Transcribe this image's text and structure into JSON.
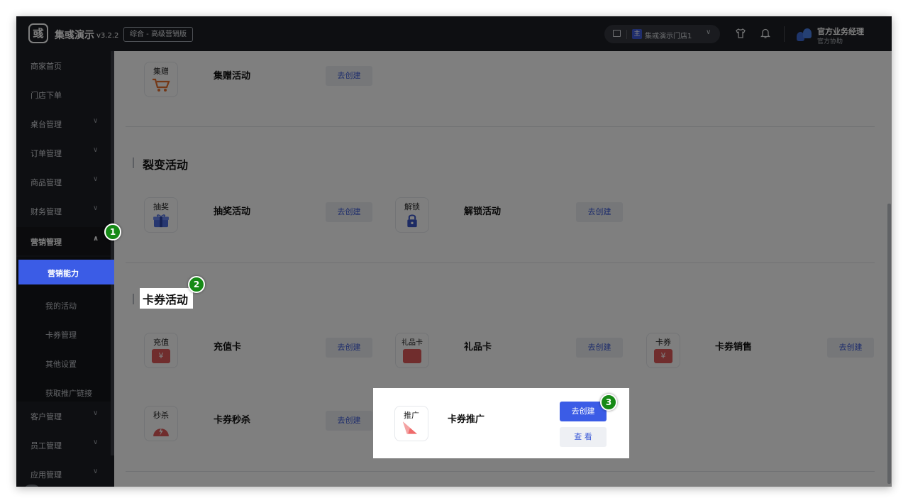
{
  "header": {
    "brand": "集彧演示",
    "version": "v3.2.2",
    "edition": "综合 - 高级营销版",
    "store_badge": "主",
    "store_name": "集彧演示门店1",
    "user_name": "官方业务经理",
    "user_sub": "官方协助"
  },
  "sidebar": {
    "items": [
      {
        "label": "商家首页"
      },
      {
        "label": "门店下单"
      },
      {
        "label": "桌台管理"
      },
      {
        "label": "订单管理"
      },
      {
        "label": "商品管理"
      },
      {
        "label": "财务管理"
      },
      {
        "label": "营销管理"
      }
    ],
    "sub_items": [
      {
        "label": "营销能力"
      },
      {
        "label": "我的活动"
      },
      {
        "label": "卡券管理"
      },
      {
        "label": "其他设置"
      },
      {
        "label": "获取推广链接"
      }
    ],
    "bottom_items": [
      {
        "label": "客户管理"
      },
      {
        "label": "员工管理"
      },
      {
        "label": "应用管理"
      }
    ]
  },
  "sections": {
    "top": {
      "tiles": [
        {
          "icon_text": "集赠",
          "name": "集赠活动",
          "button": "去创建"
        }
      ]
    },
    "fission": {
      "title": "裂变活动",
      "tiles": [
        {
          "icon_text": "抽奖",
          "name": "抽奖活动",
          "button": "去创建"
        },
        {
          "icon_text": "解锁",
          "name": "解锁活动",
          "button": "去创建"
        }
      ]
    },
    "card": {
      "title": "卡券活动",
      "tiles": [
        {
          "icon_text": "充值",
          "name": "充值卡",
          "button": "去创建"
        },
        {
          "icon_text": "礼品卡",
          "name": "礼品卡",
          "button": "去创建"
        },
        {
          "icon_text": "卡券",
          "name": "卡券销售",
          "button": "去创建"
        },
        {
          "icon_text": "秒杀",
          "name": "卡券秒杀",
          "button": "去创建"
        },
        {
          "icon_text": "推广",
          "name": "卡券推广",
          "button": "去创建",
          "button2": "查 看"
        }
      ]
    }
  },
  "markers": [
    "1",
    "2",
    "3"
  ],
  "colors": {
    "accent": "#3b5ce6",
    "topbar": "#1d1f24",
    "marker": "#168a16",
    "icon_red": "#e05a5a"
  }
}
